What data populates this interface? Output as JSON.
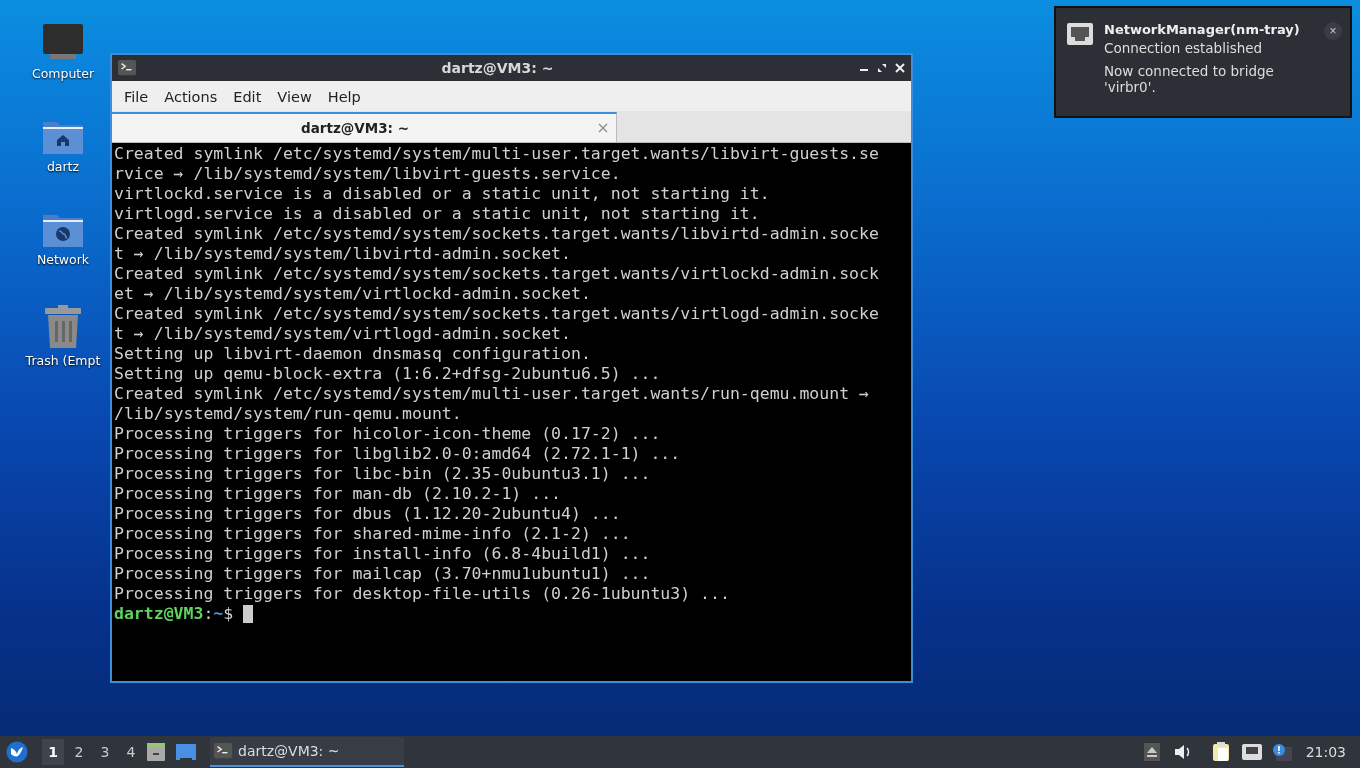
{
  "desktop_icons": [
    {
      "kind": "computer",
      "label": "Computer"
    },
    {
      "kind": "home",
      "label": "dartz"
    },
    {
      "kind": "network",
      "label": "Network"
    },
    {
      "kind": "trash",
      "label": "Trash (Empt"
    }
  ],
  "window": {
    "title": "dartz@VM3: ~",
    "menu": [
      "File",
      "Actions",
      "Edit",
      "View",
      "Help"
    ],
    "tabs": [
      {
        "label": "dartz@VM3: ~",
        "selected": true
      }
    ],
    "lines": [
      "Created symlink /etc/systemd/system/multi-user.target.wants/libvirt-guests.se",
      "rvice → /lib/systemd/system/libvirt-guests.service.",
      "virtlockd.service is a disabled or a static unit, not starting it.",
      "virtlogd.service is a disabled or a static unit, not starting it.",
      "Created symlink /etc/systemd/system/sockets.target.wants/libvirtd-admin.socke",
      "t → /lib/systemd/system/libvirtd-admin.socket.",
      "Created symlink /etc/systemd/system/sockets.target.wants/virtlockd-admin.sock",
      "et → /lib/systemd/system/virtlockd-admin.socket.",
      "Created symlink /etc/systemd/system/sockets.target.wants/virtlogd-admin.socke",
      "t → /lib/systemd/system/virtlogd-admin.socket.",
      "Setting up libvirt-daemon dnsmasq configuration.",
      "Setting up qemu-block-extra (1:6.2+dfsg-2ubuntu6.5) ...",
      "Created symlink /etc/systemd/system/multi-user.target.wants/run-qemu.mount →",
      "/lib/systemd/system/run-qemu.mount.",
      "Processing triggers for hicolor-icon-theme (0.17-2) ...",
      "Processing triggers for libglib2.0-0:amd64 (2.72.1-1) ...",
      "Processing triggers for libc-bin (2.35-0ubuntu3.1) ...",
      "Processing triggers for man-db (2.10.2-1) ...",
      "Processing triggers for dbus (1.12.20-2ubuntu4) ...",
      "Processing triggers for shared-mime-info (2.1-2) ...",
      "Processing triggers for install-info (6.8-4build1) ...",
      "Processing triggers for mailcap (3.70+nmu1ubuntu1) ...",
      "Processing triggers for desktop-file-utils (0.26-1ubuntu3) ..."
    ],
    "prompt": {
      "user": "dartz@VM3",
      "separator": ":",
      "path": "~",
      "symbol": "$"
    }
  },
  "notification": {
    "title": "NetworkManager(nm-tray)",
    "summary": "Connection established",
    "body": "Now connected to bridge 'virbr0'.",
    "close": "×"
  },
  "taskbar": {
    "workspaces": [
      {
        "label": "1",
        "selected": true
      },
      {
        "label": "2",
        "selected": false
      },
      {
        "label": "3",
        "selected": false
      },
      {
        "label": "4",
        "selected": false
      }
    ],
    "tasks": [
      {
        "label": "dartz@VM3: ~",
        "selected": true
      }
    ],
    "clock": "21:03"
  }
}
